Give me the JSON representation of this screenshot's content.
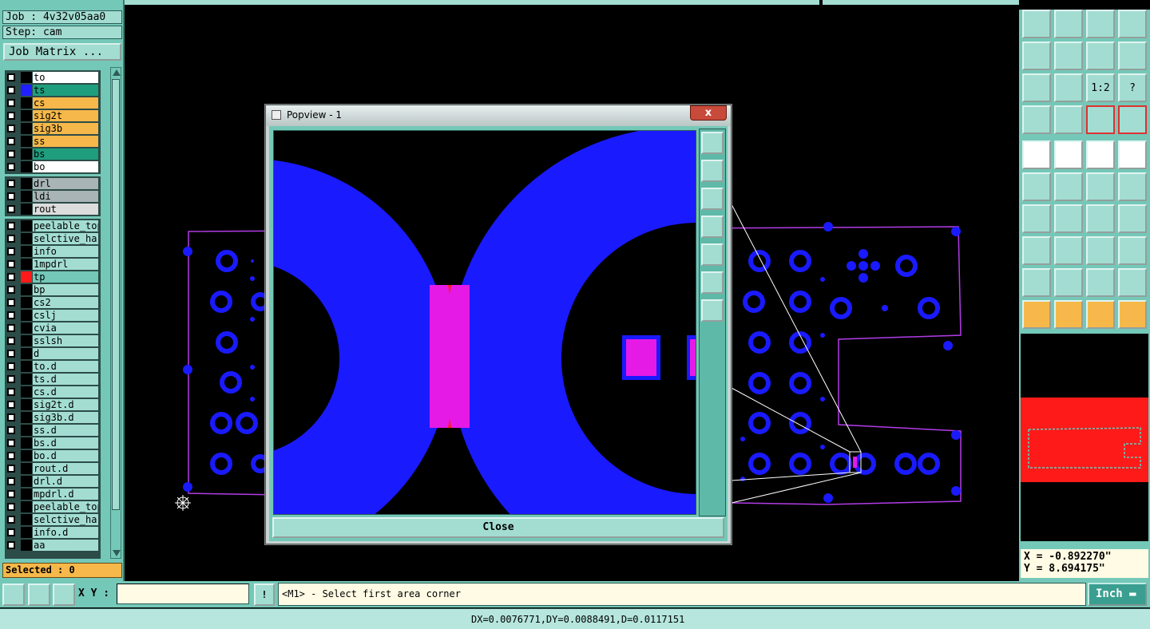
{
  "job": {
    "label": "Job : 4v32v05aa0",
    "step": "Step: cam",
    "matrix_button": "Job Matrix ..."
  },
  "layers_board": [
    {
      "name": "to",
      "color": "#ffffff",
      "swatch": "#000000"
    },
    {
      "name": "ts",
      "color": "#1f9e7e",
      "swatch": "#2020ff"
    },
    {
      "name": "cs",
      "color": "#f6b84a",
      "swatch": "#000000"
    },
    {
      "name": "sig2t",
      "color": "#f6b84a",
      "swatch": "#000000"
    },
    {
      "name": "sig3b",
      "color": "#f6b84a",
      "swatch": "#000000"
    },
    {
      "name": "ss",
      "color": "#f6b84a",
      "swatch": "#000000"
    },
    {
      "name": "bs",
      "color": "#1f9e7e",
      "swatch": "#000000"
    },
    {
      "name": "bo",
      "color": "#ffffff",
      "swatch": "#000000"
    }
  ],
  "layers_drill": [
    {
      "name": "drl",
      "color": "#a8b4b6",
      "swatch": "#000000"
    },
    {
      "name": "ldi",
      "color": "#a8b4b6",
      "swatch": "#000000"
    },
    {
      "name": "rout",
      "color": "#dcdcdc",
      "swatch": "#000000"
    }
  ],
  "layers_misc": [
    {
      "name": "peelable_top",
      "color": "#a3ddd2",
      "swatch": "#000000"
    },
    {
      "name": "selctive_hard",
      "color": "#a3ddd2",
      "swatch": "#000000"
    },
    {
      "name": "info",
      "color": "#a3ddd2",
      "swatch": "#000000"
    },
    {
      "name": "1mpdrl",
      "color": "#a3ddd2",
      "swatch": "#000000"
    },
    {
      "name": "tp",
      "color": "#74c8b8",
      "swatch": "#ff1a1a"
    },
    {
      "name": "bp",
      "color": "#a3ddd2",
      "swatch": "#000000"
    },
    {
      "name": "cs2",
      "color": "#a3ddd2",
      "swatch": "#000000"
    },
    {
      "name": "cslj",
      "color": "#a3ddd2",
      "swatch": "#000000"
    },
    {
      "name": "cvia",
      "color": "#a3ddd2",
      "swatch": "#000000"
    },
    {
      "name": "sslsh",
      "color": "#a3ddd2",
      "swatch": "#000000"
    },
    {
      "name": "d",
      "color": "#a3ddd2",
      "swatch": "#000000"
    },
    {
      "name": "to.d",
      "color": "#a3ddd2",
      "swatch": "#000000"
    },
    {
      "name": "ts.d",
      "color": "#a3ddd2",
      "swatch": "#000000"
    },
    {
      "name": "cs.d",
      "color": "#a3ddd2",
      "swatch": "#000000"
    },
    {
      "name": "sig2t.d",
      "color": "#a3ddd2",
      "swatch": "#000000"
    },
    {
      "name": "sig3b.d",
      "color": "#a3ddd2",
      "swatch": "#000000"
    },
    {
      "name": "ss.d",
      "color": "#a3ddd2",
      "swatch": "#000000"
    },
    {
      "name": "bs.d",
      "color": "#a3ddd2",
      "swatch": "#000000"
    },
    {
      "name": "bo.d",
      "color": "#a3ddd2",
      "swatch": "#000000"
    },
    {
      "name": "rout.d",
      "color": "#a3ddd2",
      "swatch": "#000000"
    },
    {
      "name": "drl.d",
      "color": "#a3ddd2",
      "swatch": "#000000"
    },
    {
      "name": "mpdrl.d",
      "color": "#a3ddd2",
      "swatch": "#000000"
    },
    {
      "name": "peelable_top",
      "color": "#a3ddd2",
      "swatch": "#000000"
    },
    {
      "name": "selctive_hard",
      "color": "#a3ddd2",
      "swatch": "#000000"
    },
    {
      "name": "info.d",
      "color": "#a3ddd2",
      "swatch": "#000000"
    },
    {
      "name": "aa",
      "color": "#a3ddd2",
      "swatch": "#000000"
    }
  ],
  "selected": "Selected : 0",
  "popup": {
    "title": "Popview - 1",
    "close_x": "x",
    "close_button": "Close"
  },
  "toolbar_icons": [
    "open-icon",
    "save-icon",
    "home-icon",
    "window-icon",
    "undo-icon",
    "redo-icon",
    "mirror-icon",
    "rotate-icon",
    "fit-icon",
    "center-icon",
    "zoom-ratio-icon",
    "help-icon",
    "settings-icon",
    "measure-icon",
    "layer-red-icon",
    "layer-red-icon-2",
    "pad-icon",
    "feature-icon",
    "ruler-icon",
    "dot-icon",
    "connect-icon",
    "delete-icon",
    "move-icon",
    "copy-icon",
    "line-icon",
    "arc-icon",
    "rotate-cw-icon",
    "text-icon",
    "resize-icon",
    "change-icon",
    "array-icon",
    "attr-icon",
    "tri-icon",
    "tri-up-icon",
    "tri-a-icon",
    "tri-b-icon",
    "select-icon",
    "box-select-icon",
    "poly-select-icon",
    "net-select-icon"
  ],
  "toolbar_labels": {
    "zoom_ratio": "1:2",
    "help": "?"
  },
  "coords": {
    "x": "X = -0.892270\"",
    "y": "Y = 8.694175\""
  },
  "bottom": {
    "xy_label": "X Y :",
    "xy_value": "",
    "prompt": "<M1> - Select first area corner",
    "units": "Inch"
  },
  "status": "DX=0.0076771,DY=0.0088491,D=0.0117151"
}
